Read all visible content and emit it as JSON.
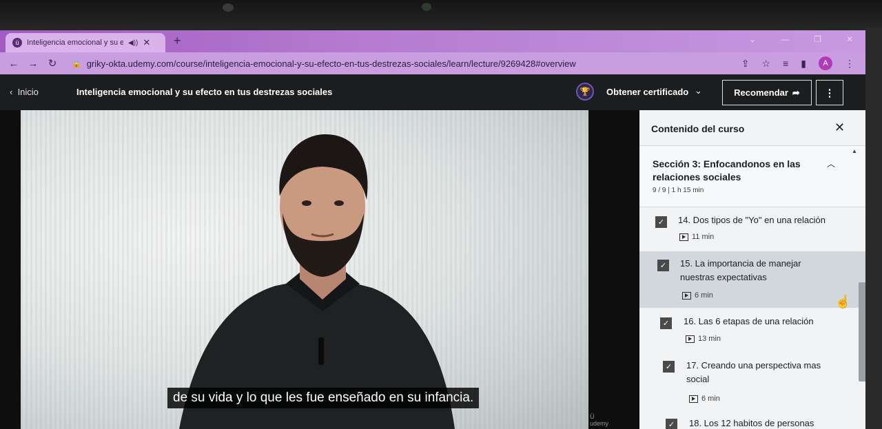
{
  "browser": {
    "tab_title": "Inteligencia emocional y su efecto",
    "tab_favicon": "udemy-icon",
    "new_tab": "+",
    "url": "griky-okta.udemy.com/course/inteligencia-emocional-y-su-efecto-en-tus-destrezas-sociales/learn/lecture/9269428#overview",
    "avatar_letter": "A"
  },
  "header": {
    "home_label": "Inicio",
    "course_title": "Inteligencia emocional y su efecto en tus destrezas sociales",
    "certificate_label": "Obtener certificado",
    "recommend_label": "Recomendar"
  },
  "video": {
    "subtitle": "de su vida y lo que les fue enseñado en su infancia."
  },
  "sidebar": {
    "title": "Contenido del curso",
    "section": {
      "title": "Sección 3: Enfocandonos en las relaciones sociales",
      "meta": "9 / 9 | 1 h 15 min"
    },
    "lectures": [
      {
        "title": "14. Dos tipos de \"Yo\" en una relación",
        "duration": "11 min",
        "completed": true,
        "active": false
      },
      {
        "title": "15. La importancia de manejar nuestras expectativas",
        "duration": "6 min",
        "completed": true,
        "active": true
      },
      {
        "title": "16. Las 6 etapas de una relación",
        "duration": "13 min",
        "completed": true,
        "active": false
      },
      {
        "title": "17. Creando una perspectiva mas social",
        "duration": "6 min",
        "completed": true,
        "active": false
      },
      {
        "title": "18. Los 12 habitos de personas",
        "duration": "",
        "completed": true,
        "active": false
      }
    ]
  },
  "colors": {
    "browser_accent": "#b47ad0",
    "udemy_header": "#1c1d1f",
    "sidebar_bg": "#f2f3f5",
    "active_lecture": "#d1d7dc"
  }
}
